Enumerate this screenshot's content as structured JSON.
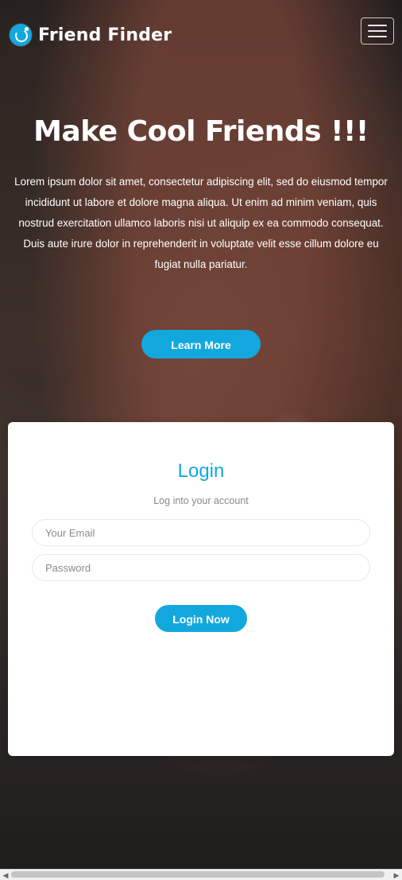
{
  "header": {
    "brand_name": "Friend Finder",
    "logo_icon": "smiley-bubble-icon",
    "menu_icon": "hamburger-menu-icon"
  },
  "hero": {
    "title": "Make Cool Friends !!!",
    "description": "Lorem ipsum dolor sit amet, consectetur adipiscing elit, sed do eiusmod tempor incididunt ut labore et dolore magna aliqua. Ut enim ad minim veniam, quis nostrud exercitation ullamco laboris nisi ut aliquip ex ea commodo consequat. Duis aute irure dolor in reprehenderit in voluptate velit esse cillum dolore eu fugiat nulla pariatur.",
    "button_label": "Learn More"
  },
  "login": {
    "title": "Login",
    "subtitle": "Log into your account",
    "email_placeholder": "Your Email",
    "password_placeholder": "Password",
    "button_label": "Login Now"
  },
  "colors": {
    "accent": "#12A8DE",
    "card_background": "#FFFFFF"
  },
  "scrollbar": {
    "left_arrow": "◀",
    "right_arrow": "▶"
  }
}
